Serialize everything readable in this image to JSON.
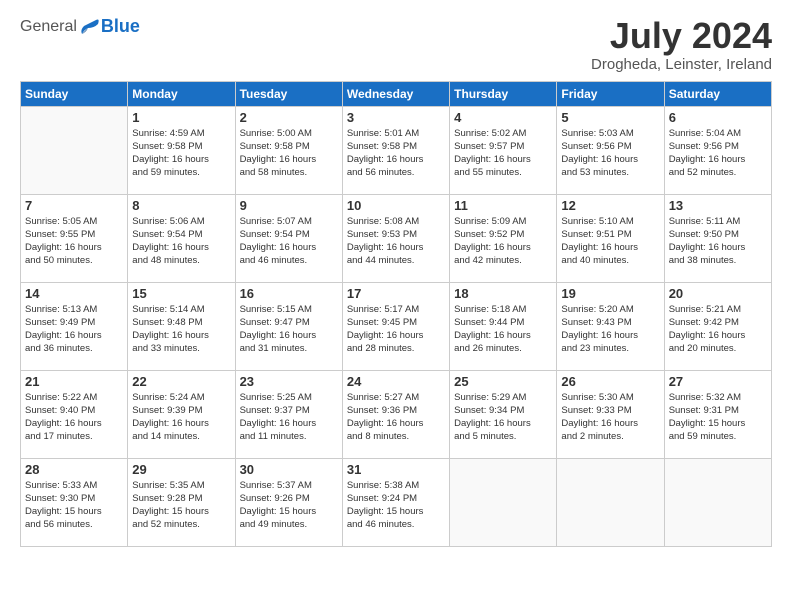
{
  "header": {
    "logo_general": "General",
    "logo_blue": "Blue",
    "title": "July 2024",
    "location": "Drogheda, Leinster, Ireland"
  },
  "days_of_week": [
    "Sunday",
    "Monday",
    "Tuesday",
    "Wednesday",
    "Thursday",
    "Friday",
    "Saturday"
  ],
  "weeks": [
    [
      {
        "day": "",
        "info": ""
      },
      {
        "day": "1",
        "info": "Sunrise: 4:59 AM\nSunset: 9:58 PM\nDaylight: 16 hours\nand 59 minutes."
      },
      {
        "day": "2",
        "info": "Sunrise: 5:00 AM\nSunset: 9:58 PM\nDaylight: 16 hours\nand 58 minutes."
      },
      {
        "day": "3",
        "info": "Sunrise: 5:01 AM\nSunset: 9:58 PM\nDaylight: 16 hours\nand 56 minutes."
      },
      {
        "day": "4",
        "info": "Sunrise: 5:02 AM\nSunset: 9:57 PM\nDaylight: 16 hours\nand 55 minutes."
      },
      {
        "day": "5",
        "info": "Sunrise: 5:03 AM\nSunset: 9:56 PM\nDaylight: 16 hours\nand 53 minutes."
      },
      {
        "day": "6",
        "info": "Sunrise: 5:04 AM\nSunset: 9:56 PM\nDaylight: 16 hours\nand 52 minutes."
      }
    ],
    [
      {
        "day": "7",
        "info": "Sunrise: 5:05 AM\nSunset: 9:55 PM\nDaylight: 16 hours\nand 50 minutes."
      },
      {
        "day": "8",
        "info": "Sunrise: 5:06 AM\nSunset: 9:54 PM\nDaylight: 16 hours\nand 48 minutes."
      },
      {
        "day": "9",
        "info": "Sunrise: 5:07 AM\nSunset: 9:54 PM\nDaylight: 16 hours\nand 46 minutes."
      },
      {
        "day": "10",
        "info": "Sunrise: 5:08 AM\nSunset: 9:53 PM\nDaylight: 16 hours\nand 44 minutes."
      },
      {
        "day": "11",
        "info": "Sunrise: 5:09 AM\nSunset: 9:52 PM\nDaylight: 16 hours\nand 42 minutes."
      },
      {
        "day": "12",
        "info": "Sunrise: 5:10 AM\nSunset: 9:51 PM\nDaylight: 16 hours\nand 40 minutes."
      },
      {
        "day": "13",
        "info": "Sunrise: 5:11 AM\nSunset: 9:50 PM\nDaylight: 16 hours\nand 38 minutes."
      }
    ],
    [
      {
        "day": "14",
        "info": "Sunrise: 5:13 AM\nSunset: 9:49 PM\nDaylight: 16 hours\nand 36 minutes."
      },
      {
        "day": "15",
        "info": "Sunrise: 5:14 AM\nSunset: 9:48 PM\nDaylight: 16 hours\nand 33 minutes."
      },
      {
        "day": "16",
        "info": "Sunrise: 5:15 AM\nSunset: 9:47 PM\nDaylight: 16 hours\nand 31 minutes."
      },
      {
        "day": "17",
        "info": "Sunrise: 5:17 AM\nSunset: 9:45 PM\nDaylight: 16 hours\nand 28 minutes."
      },
      {
        "day": "18",
        "info": "Sunrise: 5:18 AM\nSunset: 9:44 PM\nDaylight: 16 hours\nand 26 minutes."
      },
      {
        "day": "19",
        "info": "Sunrise: 5:20 AM\nSunset: 9:43 PM\nDaylight: 16 hours\nand 23 minutes."
      },
      {
        "day": "20",
        "info": "Sunrise: 5:21 AM\nSunset: 9:42 PM\nDaylight: 16 hours\nand 20 minutes."
      }
    ],
    [
      {
        "day": "21",
        "info": "Sunrise: 5:22 AM\nSunset: 9:40 PM\nDaylight: 16 hours\nand 17 minutes."
      },
      {
        "day": "22",
        "info": "Sunrise: 5:24 AM\nSunset: 9:39 PM\nDaylight: 16 hours\nand 14 minutes."
      },
      {
        "day": "23",
        "info": "Sunrise: 5:25 AM\nSunset: 9:37 PM\nDaylight: 16 hours\nand 11 minutes."
      },
      {
        "day": "24",
        "info": "Sunrise: 5:27 AM\nSunset: 9:36 PM\nDaylight: 16 hours\nand 8 minutes."
      },
      {
        "day": "25",
        "info": "Sunrise: 5:29 AM\nSunset: 9:34 PM\nDaylight: 16 hours\nand 5 minutes."
      },
      {
        "day": "26",
        "info": "Sunrise: 5:30 AM\nSunset: 9:33 PM\nDaylight: 16 hours\nand 2 minutes."
      },
      {
        "day": "27",
        "info": "Sunrise: 5:32 AM\nSunset: 9:31 PM\nDaylight: 15 hours\nand 59 minutes."
      }
    ],
    [
      {
        "day": "28",
        "info": "Sunrise: 5:33 AM\nSunset: 9:30 PM\nDaylight: 15 hours\nand 56 minutes."
      },
      {
        "day": "29",
        "info": "Sunrise: 5:35 AM\nSunset: 9:28 PM\nDaylight: 15 hours\nand 52 minutes."
      },
      {
        "day": "30",
        "info": "Sunrise: 5:37 AM\nSunset: 9:26 PM\nDaylight: 15 hours\nand 49 minutes."
      },
      {
        "day": "31",
        "info": "Sunrise: 5:38 AM\nSunset: 9:24 PM\nDaylight: 15 hours\nand 46 minutes."
      },
      {
        "day": "",
        "info": ""
      },
      {
        "day": "",
        "info": ""
      },
      {
        "day": "",
        "info": ""
      }
    ]
  ]
}
